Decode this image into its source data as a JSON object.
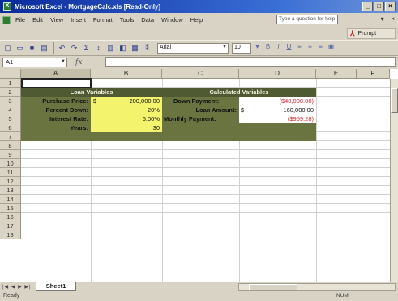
{
  "window": {
    "title": "Microsoft Excel - MortgageCalc.xls  [Read-Only]",
    "controls": [
      "_",
      "□",
      "×"
    ]
  },
  "menu": {
    "items": [
      "File",
      "Edit",
      "View",
      "Insert",
      "Format",
      "Tools",
      "Data",
      "Window",
      "Help"
    ],
    "help_placeholder": "Type a question for help",
    "doc_controls": [
      "▾",
      "-",
      "×"
    ]
  },
  "acrobat": {
    "prompt_label": "Prompt"
  },
  "toolbar": {
    "font": "Arial",
    "size": "10"
  },
  "formula_bar": {
    "name_box": "A1",
    "fx": "fx",
    "content": ""
  },
  "grid": {
    "columns": [
      "A",
      "B",
      "C",
      "D",
      "E",
      "F"
    ],
    "rows": [
      "1",
      "2",
      "3",
      "4",
      "5",
      "6",
      "7",
      "8",
      "9",
      "10",
      "11",
      "12",
      "13",
      "14",
      "15",
      "16",
      "17",
      "18"
    ]
  },
  "sheet": {
    "loan_header": "Loan Variables",
    "calc_header": "Calculated Variables",
    "purchase_price_label": "Purchase Price:",
    "purchase_price_currency": "$",
    "purchase_price_value": "200,000.00",
    "percent_down_label": "Percent Down:",
    "percent_down_value": "20%",
    "interest_rate_label": "Interest Rate:",
    "interest_rate_value": "6.00%",
    "years_label": "Years:",
    "years_value": "30",
    "down_payment_label": "Down Payment:",
    "down_payment_value": "($40,000.00)",
    "loan_amount_label": "Loan Amount:",
    "loan_amount_currency": "$",
    "loan_amount_value": "160,000.00",
    "monthly_payment_label": "Monthly Payment:",
    "monthly_payment_value": "($959.28)"
  },
  "tabs": {
    "nav": "|◀ ◀ ▶ ▶|",
    "sheet1": "Sheet1"
  },
  "status": {
    "left": "Ready",
    "right": "NUM"
  },
  "colors": {
    "band": "#4f5a32",
    "olive": "#6a7440",
    "input": "#f4f36e",
    "negative": "#d2262b"
  }
}
